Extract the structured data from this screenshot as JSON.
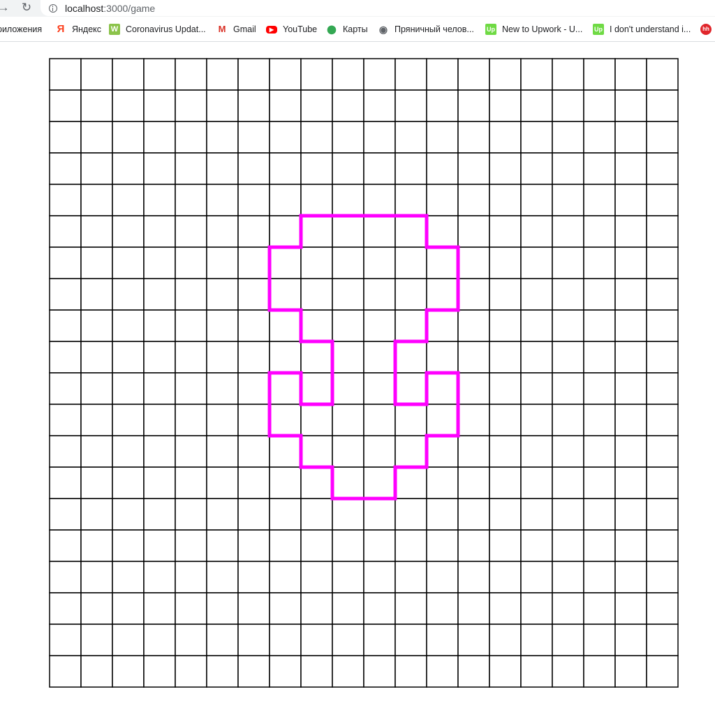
{
  "browser": {
    "url_host": "localhost",
    "url_path": ":3000/game",
    "back_glyph": "→",
    "reload_glyph": "↻"
  },
  "bookmarks": [
    {
      "label": "риложения",
      "icon": "apps-icon",
      "icon_text": "",
      "icon_color": "#5f6368"
    },
    {
      "label": "Яндекс",
      "icon": "yandex-icon",
      "icon_text": "Я",
      "icon_color": "#fc3f1d"
    },
    {
      "label": "Coronavirus Updat...",
      "icon": "worldometer-icon",
      "icon_text": "W",
      "icon_color": "#8bc34a"
    },
    {
      "label": "Gmail",
      "icon": "gmail-icon",
      "icon_text": "M",
      "icon_color": "#d93025"
    },
    {
      "label": "YouTube",
      "icon": "youtube-icon",
      "icon_text": "▶",
      "icon_color": "#ff0000"
    },
    {
      "label": "Карты",
      "icon": "maps-icon",
      "icon_text": "⬤",
      "icon_color": "#34a853"
    },
    {
      "label": "Пряничный челов...",
      "icon": "globe-icon",
      "icon_text": "◉",
      "icon_color": "#5f6368"
    },
    {
      "label": "New to Upwork - U...",
      "icon": "upwork-icon",
      "icon_text": "Up",
      "icon_color": "#6fda44"
    },
    {
      "label": "I don't understand i...",
      "icon": "upwork-icon",
      "icon_text": "Up",
      "icon_color": "#6fda44"
    },
    {
      "label": "",
      "icon": "hh-icon",
      "icon_text": "hh",
      "icon_color": "#e0262b"
    }
  ],
  "game": {
    "rows": 20,
    "cols": 20,
    "grid_color": "#000000",
    "shape_color": "#ff00ff",
    "shape_cells": [
      [
        5,
        8
      ],
      [
        5,
        9
      ],
      [
        5,
        10
      ],
      [
        5,
        11
      ],
      [
        6,
        7
      ],
      [
        6,
        8
      ],
      [
        6,
        9
      ],
      [
        6,
        10
      ],
      [
        6,
        11
      ],
      [
        6,
        12
      ],
      [
        7,
        7
      ],
      [
        7,
        8
      ],
      [
        7,
        9
      ],
      [
        7,
        10
      ],
      [
        7,
        11
      ],
      [
        7,
        12
      ],
      [
        8,
        8
      ],
      [
        8,
        9
      ],
      [
        8,
        10
      ],
      [
        8,
        11
      ],
      [
        9,
        9
      ],
      [
        9,
        10
      ],
      [
        10,
        7
      ],
      [
        10,
        9
      ],
      [
        10,
        10
      ],
      [
        10,
        12
      ],
      [
        11,
        7
      ],
      [
        11,
        8
      ],
      [
        11,
        9
      ],
      [
        11,
        10
      ],
      [
        11,
        11
      ],
      [
        11,
        12
      ],
      [
        12,
        8
      ],
      [
        12,
        9
      ],
      [
        12,
        10
      ],
      [
        12,
        11
      ],
      [
        13,
        9
      ],
      [
        13,
        10
      ]
    ]
  }
}
